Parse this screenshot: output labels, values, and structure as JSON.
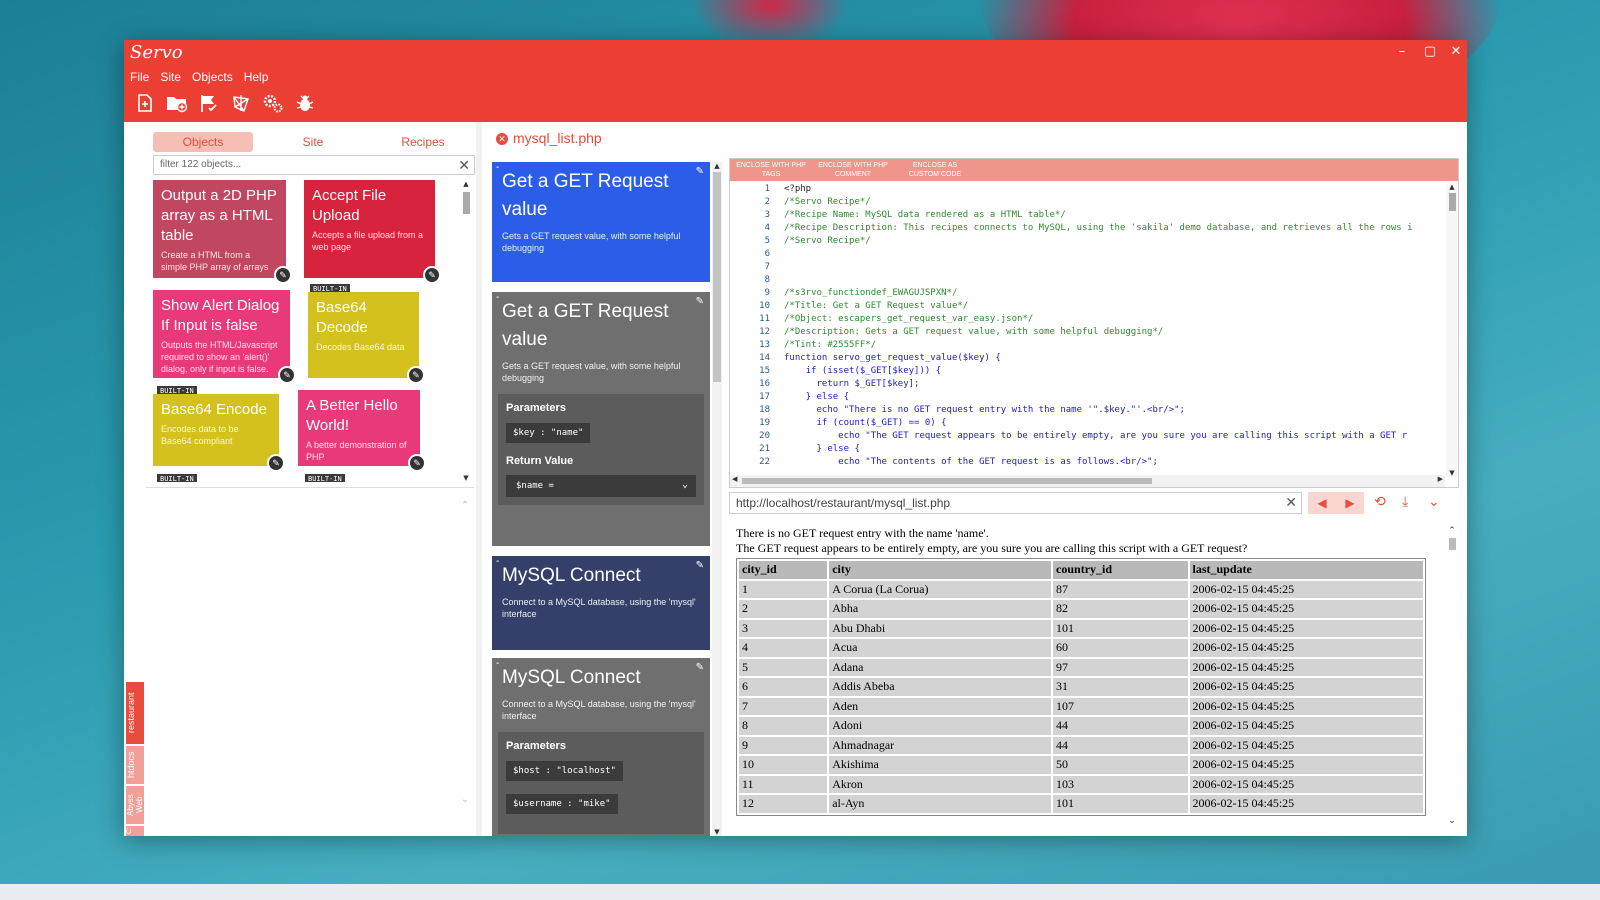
{
  "app": {
    "title": "Servo",
    "window_controls": [
      "–",
      "▢",
      "✕"
    ]
  },
  "menu": [
    "File",
    "Site",
    "Objects",
    "Help"
  ],
  "toolbar_icons": [
    "new-site-icon",
    "new-folder-icon",
    "flag-check-icon",
    "network-icon",
    "gears-icon",
    "bug-icon"
  ],
  "tabs": {
    "objects": "Objects",
    "site": "Site",
    "recipes": "Recipes"
  },
  "filter": {
    "placeholder": "filter 122 objects..."
  },
  "objects": [
    {
      "title": "Output a 2D PHP array as a HTML table",
      "desc": "Create a HTML from a simple PHP array of arrays",
      "color": "#c0475f"
    },
    {
      "title": "Accept File Upload",
      "desc": "Accepts a file upload from a web page",
      "color": "#d8233c"
    },
    {
      "title": "Show Alert Dialog If Input is false",
      "desc": "Outputs the HTML/Javascript required to show an 'alert()' dialog, only if input is false.",
      "color": "#e83a78"
    },
    {
      "title": "Base64 Decode",
      "desc": "Decodes Base64 data",
      "color": "#d4c11e",
      "badge": "BUILT-IN"
    },
    {
      "title": "Base64 Encode",
      "desc": "Encodes data to be Base64 compliant",
      "color": "#d4c11e",
      "badge": "BUILT-IN"
    },
    {
      "title": "A Better Hello World!",
      "desc": "A better demonstration of PHP",
      "color": "#e83a78"
    }
  ],
  "more_badges": [
    "BUILT-IN",
    "BUILT-IN"
  ],
  "sidebar_breadcrumb": [
    "restaurant",
    "htdocs",
    "Abyss Web Server",
    "C:"
  ],
  "file_tab": {
    "name": "mysql_list.php"
  },
  "functions": [
    {
      "title": "Get a GET Request value",
      "desc": "Gets a GET request value, with some helpful debugging",
      "color": "#2c5de8"
    },
    {
      "title": "Get a GET Request value",
      "desc": "Gets a GET request value, with some helpful debugging",
      "color": "#6f6f6f",
      "params_label": "Parameters",
      "param": "$key  : \"name\"",
      "return_label": "Return Value",
      "return": "$name ="
    },
    {
      "title": "MySQL Connect",
      "desc": "Connect to a MySQL database, using the 'mysql' interface",
      "color": "#34406a"
    },
    {
      "title": "MySQL Connect",
      "desc": "Connect to a MySQL database, using the 'mysql' interface",
      "color": "#6f6f6f",
      "params_label": "Parameters",
      "param": "$host  : \"localhost\"",
      "param2": "$username : \"mike\""
    }
  ],
  "code_buttons": [
    "ENCLOSE WITH PHP TAGS",
    "ENCLOSE WITH PHP COMMENT",
    "ENCLOSE AS CUSTOM CODE"
  ],
  "code": [
    {
      "n": "1",
      "text": "<?php"
    },
    {
      "n": "2",
      "text": "/*Servo Recipe*/"
    },
    {
      "n": "3",
      "text": "/*Recipe Name: MySQL data rendered as a HTML table*/"
    },
    {
      "n": "4",
      "text": "/*Recipe Description: This recipes connects to MySQL, using the 'sakila' demo database, and retrieves all the rows i"
    },
    {
      "n": "5",
      "text": "/*Servo Recipe*/"
    },
    {
      "n": "6",
      "text": ""
    },
    {
      "n": "7",
      "text": ""
    },
    {
      "n": "8",
      "text": ""
    },
    {
      "n": "9",
      "text": "/*s3rvo_functiondef_EWAGUJSPXN*/"
    },
    {
      "n": "10",
      "text": "/*Title: Get a GET Request value*/"
    },
    {
      "n": "11",
      "text": "/*Object: escapers_get_request_var_easy.json*/"
    },
    {
      "n": "12",
      "text": "/*Description: Gets a GET request value, with some helpful debugging*/"
    },
    {
      "n": "13",
      "text": "/*Tint: #2555FF*/"
    },
    {
      "n": "14",
      "text": "function servo_get_request_value($key) {"
    },
    {
      "n": "15",
      "text": "    if (isset($_GET[$key])) {"
    },
    {
      "n": "16",
      "text": "      return $_GET[$key];"
    },
    {
      "n": "17",
      "text": "    } else {"
    },
    {
      "n": "18",
      "text": "      echo \"There is no GET request entry with the name '\".$key.\"'.<br/>\";"
    },
    {
      "n": "19",
      "text": "      if (count($_GET) == 0) {"
    },
    {
      "n": "20",
      "text": "          echo \"The GET request appears to be entirely empty, are you sure you are calling this script with a GET r"
    },
    {
      "n": "21",
      "text": "      } else {"
    },
    {
      "n": "22",
      "text": "          echo \"The contents of the GET request is as follows.<br/>\";"
    }
  ],
  "url": {
    "value": "http://localhost/restaurant/mysql_list.php"
  },
  "output": {
    "line1": "There is no GET request entry with the name 'name'.",
    "line2": "The GET request appears to be entirely empty, are you sure you are calling this script with a GET request?",
    "headers": [
      "city_id",
      "city",
      "country_id",
      "last_update"
    ],
    "rows": [
      [
        "1",
        "A Corua (La Corua)",
        "87",
        "2006-02-15 04:45:25"
      ],
      [
        "2",
        "Abha",
        "82",
        "2006-02-15 04:45:25"
      ],
      [
        "3",
        "Abu Dhabi",
        "101",
        "2006-02-15 04:45:25"
      ],
      [
        "4",
        "Acua",
        "60",
        "2006-02-15 04:45:25"
      ],
      [
        "5",
        "Adana",
        "97",
        "2006-02-15 04:45:25"
      ],
      [
        "6",
        "Addis Abeba",
        "31",
        "2006-02-15 04:45:25"
      ],
      [
        "7",
        "Aden",
        "107",
        "2006-02-15 04:45:25"
      ],
      [
        "8",
        "Adoni",
        "44",
        "2006-02-15 04:45:25"
      ],
      [
        "9",
        "Ahmadnagar",
        "44",
        "2006-02-15 04:45:25"
      ],
      [
        "10",
        "Akishima",
        "50",
        "2006-02-15 04:45:25"
      ],
      [
        "11",
        "Akron",
        "103",
        "2006-02-15 04:45:25"
      ],
      [
        "12",
        "al-Ayn",
        "101",
        "2006-02-15 04:45:25"
      ]
    ]
  }
}
